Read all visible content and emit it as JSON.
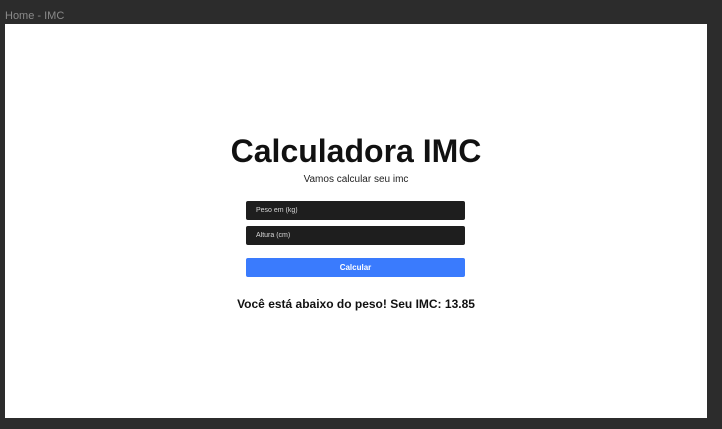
{
  "window": {
    "title": "Home - IMC"
  },
  "page": {
    "title": "Calculadora IMC",
    "subtitle": "Vamos calcular seu imc"
  },
  "form": {
    "weight": {
      "placeholder": "Peso em (kg)",
      "value": ""
    },
    "height": {
      "placeholder": "Altura (cm)",
      "value": ""
    },
    "submit_label": "Calcular"
  },
  "result": {
    "text": "Você está abaixo do peso! Seu IMC: 13.85"
  },
  "colors": {
    "background": "#2c2c2c",
    "canvas": "#ffffff",
    "input": "#1e1e1e",
    "accent": "#3a7bfd",
    "text": "#111111"
  }
}
